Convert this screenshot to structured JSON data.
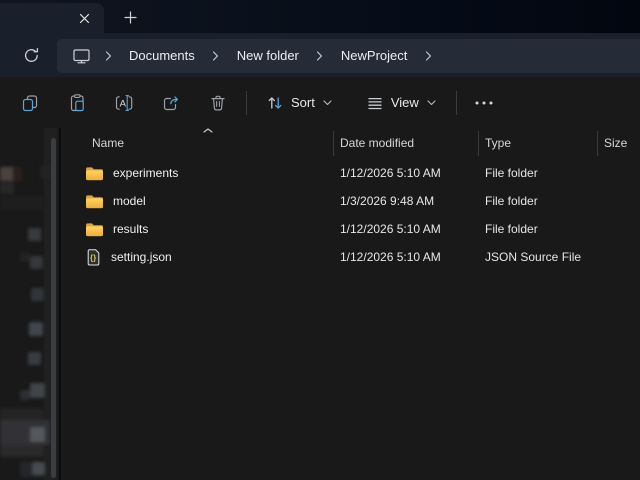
{
  "tab_bar": {
    "close_icon": "✕",
    "new_tab_icon": "+"
  },
  "address_bar": {
    "breadcrumbs": [
      "Documents",
      "New folder",
      "NewProject"
    ]
  },
  "toolbar": {
    "sort_label": "Sort",
    "view_label": "View"
  },
  "file_list": {
    "columns": [
      "Name",
      "Date modified",
      "Type",
      "Size"
    ],
    "rows": [
      {
        "name": "experiments",
        "date_modified": "1/12/2026 5:10 AM",
        "type": "File folder",
        "size": ""
      },
      {
        "name": "model",
        "date_modified": "1/3/2026 9:48 AM",
        "type": "File folder",
        "size": ""
      },
      {
        "name": "results",
        "date_modified": "1/12/2026 5:10 AM",
        "type": "File folder",
        "size": ""
      },
      {
        "name": "setting.json",
        "date_modified": "1/12/2026 5:10 AM",
        "type": "JSON Source File",
        "size": ""
      }
    ]
  },
  "colors": {
    "accent_blue": "#58a6d8",
    "folder_yellow_light": "#ffd563",
    "folder_yellow_dark": "#f0ae3c",
    "titlebar": "#050b16",
    "surface": "#1a202b",
    "field": "#252c38",
    "content_bg": "#191919"
  }
}
